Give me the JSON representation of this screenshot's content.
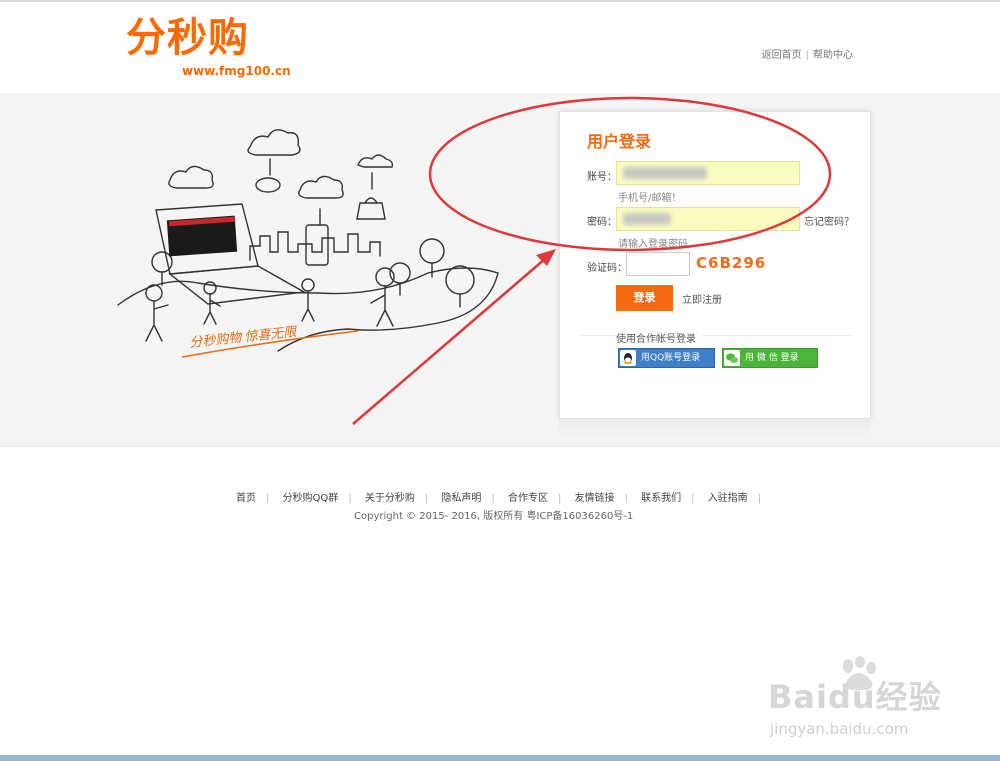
{
  "header": {
    "logo_text": "分秒购",
    "logo_url": "www.fmg100.cn",
    "links": [
      "返回首页",
      "帮助中心"
    ]
  },
  "illustration": {
    "slogan": "分秒购物  惊喜无限"
  },
  "login": {
    "title": "用户登录",
    "account_label": "账号：",
    "account_hint": "手机号/邮箱！",
    "password_label": "密码：",
    "password_hint": "请输入登录密码",
    "forgot": "忘记密码？",
    "captcha_label": "验证码：",
    "captcha_code": "C6B296",
    "login_button": "登录",
    "register": "立即注册",
    "coop_title": "使用合作帐号登录",
    "qq_button": "用QQ账号登录",
    "wechat_button": "用 微 信  登录"
  },
  "footer": {
    "links": [
      "首页",
      "分秒购QQ群",
      "关于分秒购",
      "隐私声明",
      "合作专区",
      "友情链接",
      "联系我们",
      "入驻指南"
    ],
    "copyright": "Copyright © 2015- 2016, 版权所有 粤ICP备16036260号-1"
  },
  "watermark": {
    "brand": "Baidu经验",
    "url": "jingyan.baidu.com"
  },
  "colors": {
    "accent": "#f26a12",
    "annotation": "#e0383a"
  },
  "icons": [
    "qq-icon",
    "wechat-icon",
    "baidu-paw-icon"
  ]
}
